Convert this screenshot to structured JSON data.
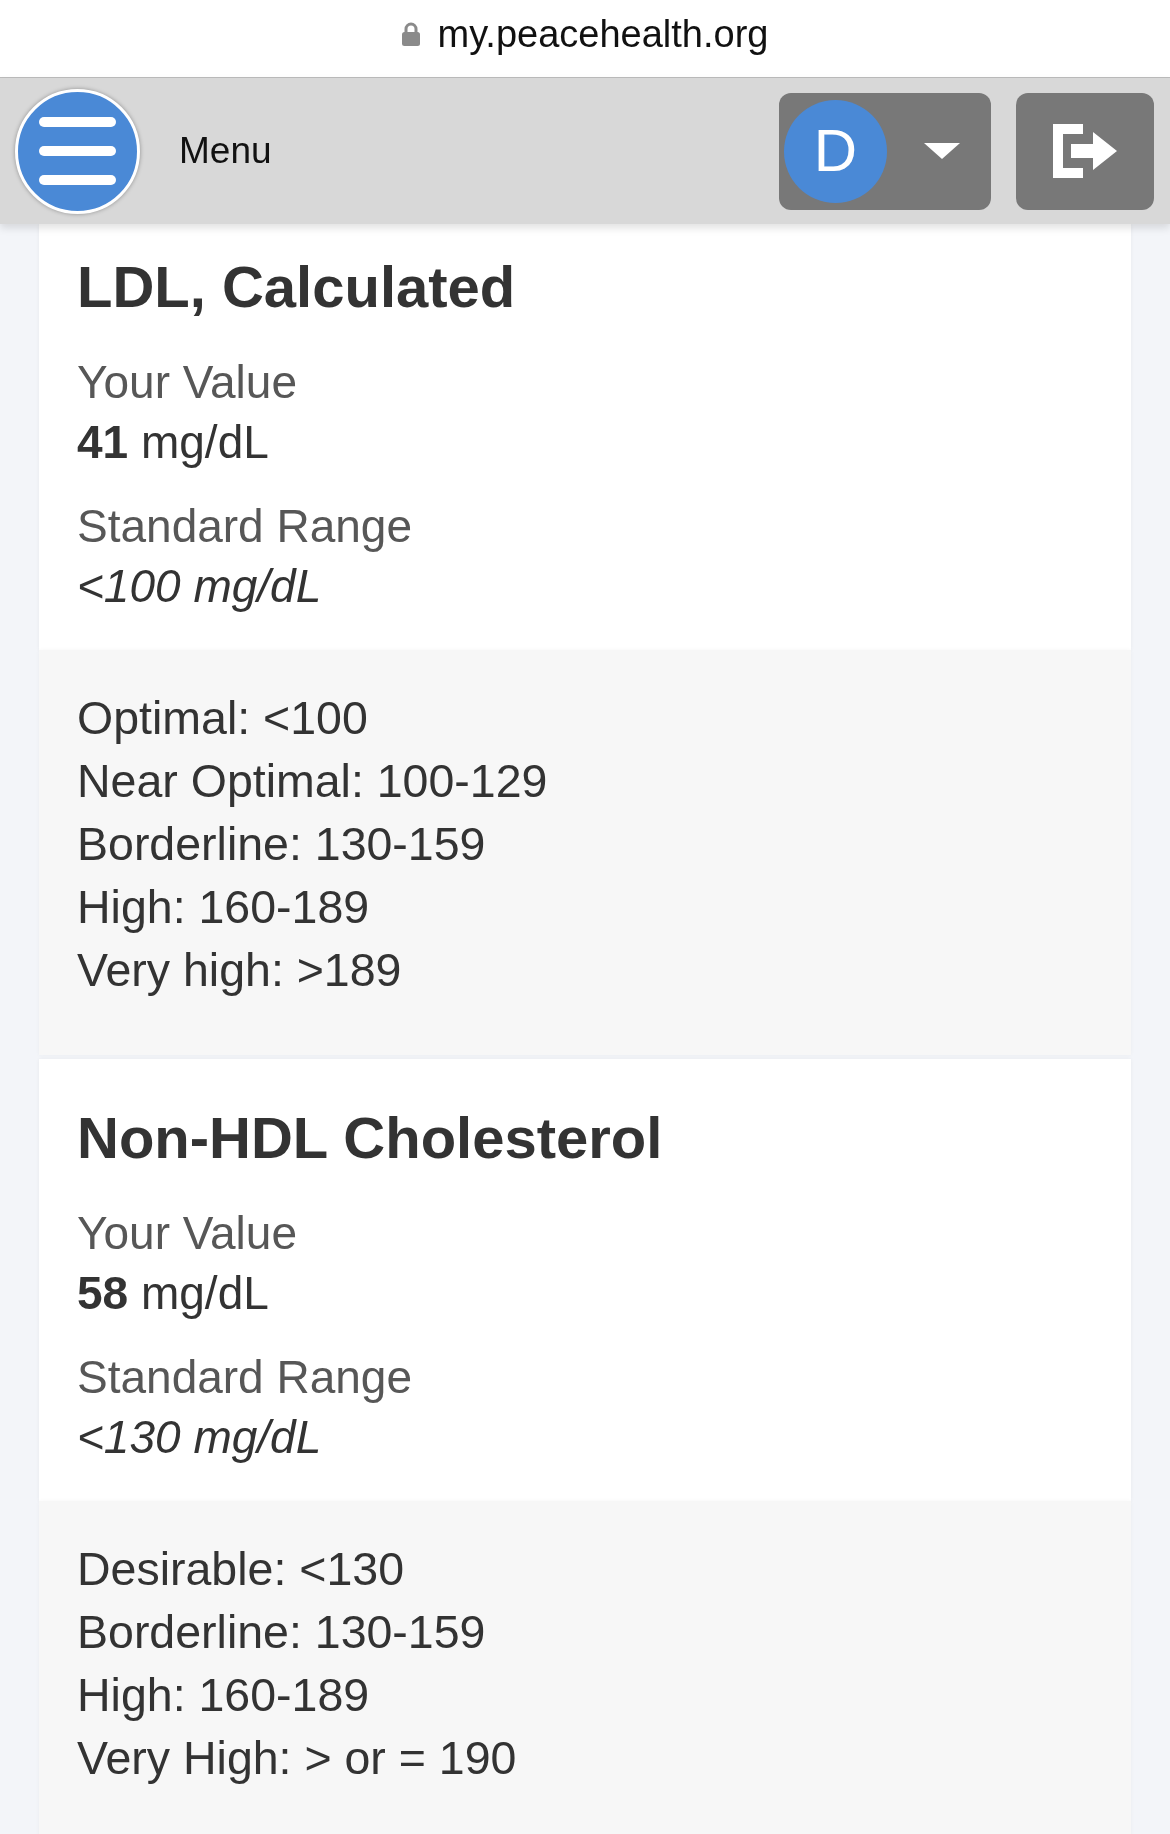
{
  "browser": {
    "url": "my.peacehealth.org"
  },
  "header": {
    "menu_label": "Menu",
    "user_initial": "D"
  },
  "results": [
    {
      "title": "LDL, Calculated",
      "value_label": "Your Value",
      "value": "**41** mg/dL",
      "range_label": "Standard Range",
      "range": "<100 mg/dL",
      "reference_ranges": [
        "Optimal: <100",
        "Near Optimal: 100-129",
        "Borderline: 130-159",
        "High: 160-189",
        "Very high: >189"
      ]
    },
    {
      "title": "Non-HDL Cholesterol",
      "value_label": "Your Value",
      "value": "**58** mg/dL",
      "range_label": "Standard Range",
      "range": "<130 mg/dL",
      "reference_ranges": [
        "Desirable: <130",
        "Borderline: 130-159",
        "High: 160-189",
        "Very High: > or = 190"
      ]
    }
  ]
}
